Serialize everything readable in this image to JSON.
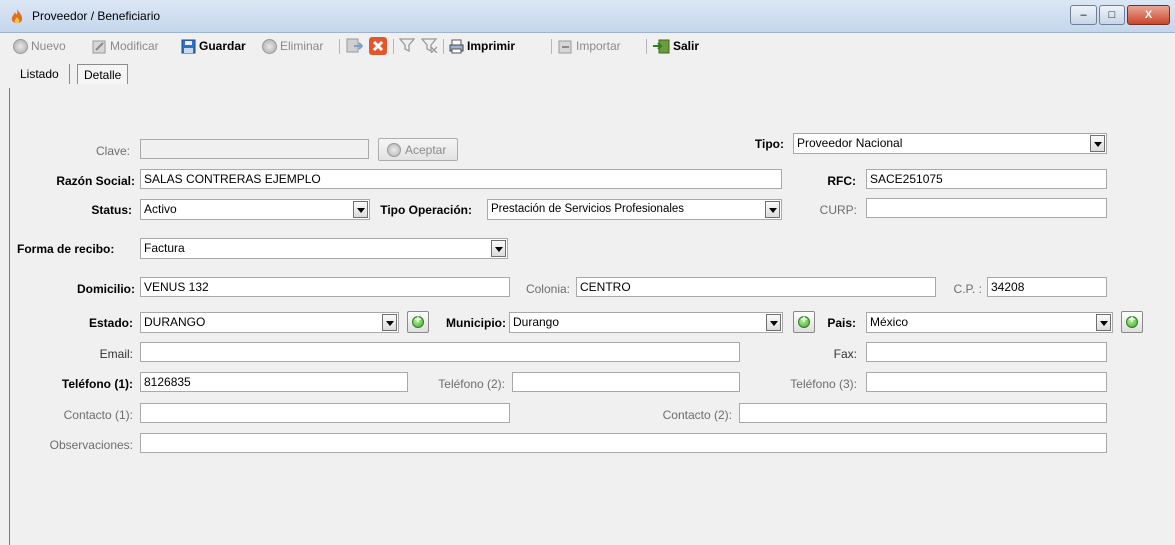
{
  "window": {
    "title": "Proveedor / Beneficiario",
    "min": "–",
    "max": "□",
    "close": "X"
  },
  "toolbar": {
    "nuevo": "Nuevo",
    "modificar": "Modificar",
    "guardar": "Guardar",
    "eliminar": "Eliminar",
    "imprimir": "Imprimir",
    "importar": "Importar",
    "salir": "Salir"
  },
  "tabs": {
    "listado": "Listado",
    "detalle": "Detalle"
  },
  "form": {
    "clave": {
      "label": "Clave:",
      "value": ""
    },
    "aceptar": "Aceptar",
    "tipo": {
      "label": "Tipo:",
      "value": "Proveedor Nacional"
    },
    "razon_social": {
      "label": "Razón Social:",
      "value": "SALAS CONTRERAS EJEMPLO"
    },
    "rfc": {
      "label": "RFC:",
      "value": "SACE251075"
    },
    "status": {
      "label": "Status:",
      "value": "Activo"
    },
    "tipo_operacion": {
      "label": "Tipo Operación:",
      "value": "Prestación de Servicios Profesionales"
    },
    "curp": {
      "label": "CURP:",
      "value": ""
    },
    "forma_recibo": {
      "label": "Forma de recibo:",
      "value": "Factura"
    },
    "domicilio": {
      "label": "Domicilio:",
      "value": "VENUS 132"
    },
    "colonia": {
      "label": "Colonia:",
      "value": "CENTRO"
    },
    "cp": {
      "label": "C.P. :",
      "value": "34208"
    },
    "estado": {
      "label": "Estado:",
      "value": "DURANGO"
    },
    "municipio": {
      "label": "Municipio:",
      "value": "Durango"
    },
    "pais": {
      "label": "Pais:",
      "value": "México"
    },
    "email": {
      "label": "Email:",
      "value": ""
    },
    "fax": {
      "label": "Fax:",
      "value": ""
    },
    "telefono1": {
      "label": "Teléfono (1):",
      "value": "8126835"
    },
    "telefono2": {
      "label": "Teléfono (2):",
      "value": ""
    },
    "telefono3": {
      "label": "Teléfono (3):",
      "value": ""
    },
    "contacto1": {
      "label": "Contacto (1):",
      "value": ""
    },
    "contacto2": {
      "label": "Contacto (2):",
      "value": ""
    },
    "observaciones": {
      "label": "Observaciones:",
      "value": ""
    }
  },
  "colors": {
    "accent_green": "#3fa82a",
    "close_red": "#c9462c",
    "disabled_text": "#8a8a8a"
  }
}
